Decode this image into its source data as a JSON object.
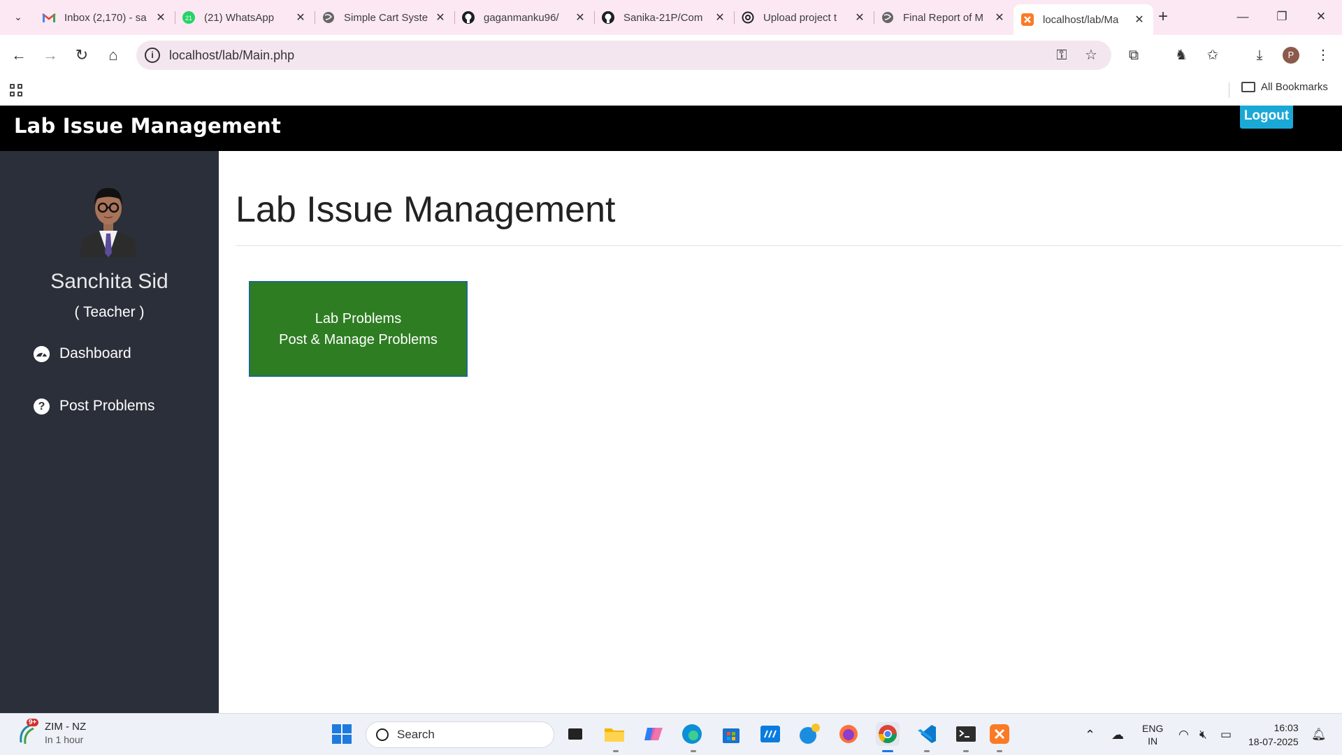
{
  "browser": {
    "tabs": [
      {
        "title": "Inbox (2,170) - sa",
        "icon": "gmail-icon"
      },
      {
        "title": "(21) WhatsApp",
        "icon": "whatsapp-icon"
      },
      {
        "title": "Simple Cart Syste",
        "icon": "globe-icon"
      },
      {
        "title": "gaganmanku96/",
        "icon": "github-icon"
      },
      {
        "title": "Sanika-21P/Com",
        "icon": "github-icon"
      },
      {
        "title": "Upload project t",
        "icon": "chatgpt-icon"
      },
      {
        "title": "Final Report of M",
        "icon": "globe-icon"
      },
      {
        "title": "localhost/lab/Ma",
        "icon": "xampp-icon"
      }
    ],
    "url": "localhost/lab/Main.php",
    "all_bookmarks_label": "All Bookmarks",
    "profile_initial": "P",
    "whatsapp_badge": "21"
  },
  "app": {
    "brand": "Lab Issue Management",
    "logout_label": "Logout",
    "user": {
      "name": "Sanchita Sid",
      "role": "( Teacher )"
    },
    "nav": [
      {
        "label": "Dashboard",
        "icon": "dashboard-icon"
      },
      {
        "label": "Post Problems",
        "icon": "question-circle-icon"
      }
    ],
    "main": {
      "title": "Lab Issue Management",
      "card": {
        "line1": "Lab Problems",
        "line2": "Post & Manage Problems"
      }
    },
    "colors": {
      "topbar": "#000000",
      "sidebar": "#2b2f3a",
      "logout": "#1aa9d6",
      "card": "#2e7d22"
    }
  },
  "taskbar": {
    "weather_title": "ZIM - NZ",
    "weather_sub": "In 1 hour",
    "weather_badge": "9+",
    "search_placeholder": "Search",
    "lang_line1": "ENG",
    "lang_line2": "IN",
    "time": "16:03",
    "date": "18-07-2025"
  }
}
